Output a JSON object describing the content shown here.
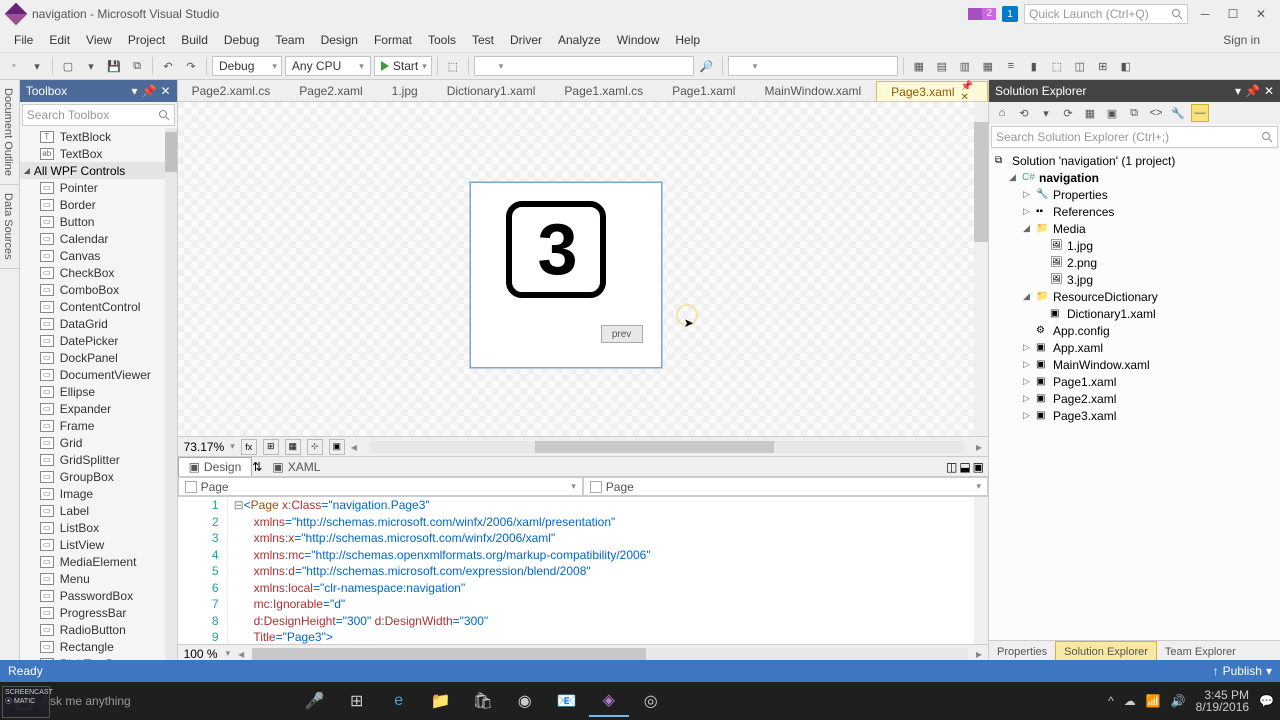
{
  "titlebar": {
    "title": "navigation - Microsoft Visual Studio",
    "flag_count": "2",
    "notif_count": "1",
    "quicklaunch_placeholder": "Quick Launch (Ctrl+Q)"
  },
  "menu": {
    "items": [
      "File",
      "Edit",
      "View",
      "Project",
      "Build",
      "Debug",
      "Team",
      "Design",
      "Format",
      "Tools",
      "Test",
      "Driver",
      "Analyze",
      "Window",
      "Help"
    ],
    "signin": "Sign in"
  },
  "toolbar": {
    "config": "Debug",
    "platform": "Any CPU",
    "start": "Start"
  },
  "leftrail": [
    "Document Outline",
    "Data Sources"
  ],
  "toolbox": {
    "title": "Toolbox",
    "search_placeholder": "Search Toolbox",
    "items_top": [
      "TextBlock",
      "TextBox"
    ],
    "cat": "All WPF Controls",
    "items": [
      "Pointer",
      "Border",
      "Button",
      "Calendar",
      "Canvas",
      "CheckBox",
      "ComboBox",
      "ContentControl",
      "DataGrid",
      "DatePicker",
      "DockPanel",
      "DocumentViewer",
      "Ellipse",
      "Expander",
      "Frame",
      "Grid",
      "GridSplitter",
      "GroupBox",
      "Image",
      "Label",
      "ListBox",
      "ListView",
      "MediaElement",
      "Menu",
      "PasswordBox",
      "ProgressBar",
      "RadioButton",
      "Rectangle",
      "RichTextBox"
    ]
  },
  "doctabs": [
    "Page2.xaml.cs",
    "Page2.xaml",
    "1.jpg",
    "Dictionary1.xaml",
    "Page1.xaml.cs",
    "Page1.xaml",
    "MainWindow.xaml",
    "Page3.xaml"
  ],
  "doctab_active": "Page3.xaml",
  "designer": {
    "number": "3",
    "prev": "prev"
  },
  "zoom": "73.17%",
  "split": {
    "design": "Design",
    "xaml": "XAML"
  },
  "dd": {
    "left": "Page",
    "right": "Page"
  },
  "code": {
    "lines": [
      "<Page x:Class=\"navigation.Page3\"",
      "      xmlns=\"http://schemas.microsoft.com/winfx/2006/xaml/presentation\"",
      "      xmlns:x=\"http://schemas.microsoft.com/winfx/2006/xaml\"",
      "      xmlns:mc=\"http://schemas.openxmlformats.org/markup-compatibility/2006\"",
      "      xmlns:d=\"http://schemas.microsoft.com/expression/blend/2008\"",
      "      xmlns:local=\"clr-namespace:navigation\"",
      "      mc:Ignorable=\"d\"",
      "      d:DesignHeight=\"300\" d:DesignWidth=\"300\"",
      "      Title=\"Page3\">"
    ],
    "zoom": "100 %"
  },
  "solex": {
    "title": "Solution Explorer",
    "search_placeholder": "Search Solution Explorer (Ctrl+;)",
    "solution": "Solution 'navigation' (1 project)",
    "project": "navigation",
    "nodes": {
      "properties": "Properties",
      "references": "References",
      "media": "Media",
      "m1": "1.jpg",
      "m2": "2.png",
      "m3": "3.jpg",
      "resdict": "ResourceDictionary",
      "dict1": "Dictionary1.xaml",
      "appcfg": "App.config",
      "appx": "App.xaml",
      "mainw": "MainWindow.xaml",
      "p1": "Page1.xaml",
      "p2": "Page2.xaml",
      "p3": "Page3.xaml"
    },
    "bottabs": [
      "Properties",
      "Solution Explorer",
      "Team Explorer"
    ]
  },
  "status": {
    "ready": "Ready",
    "publish": "Publish"
  },
  "taskbar": {
    "search_placeholder": "Ask me anything",
    "time": "3:45 PM",
    "date": "8/19/2016"
  }
}
